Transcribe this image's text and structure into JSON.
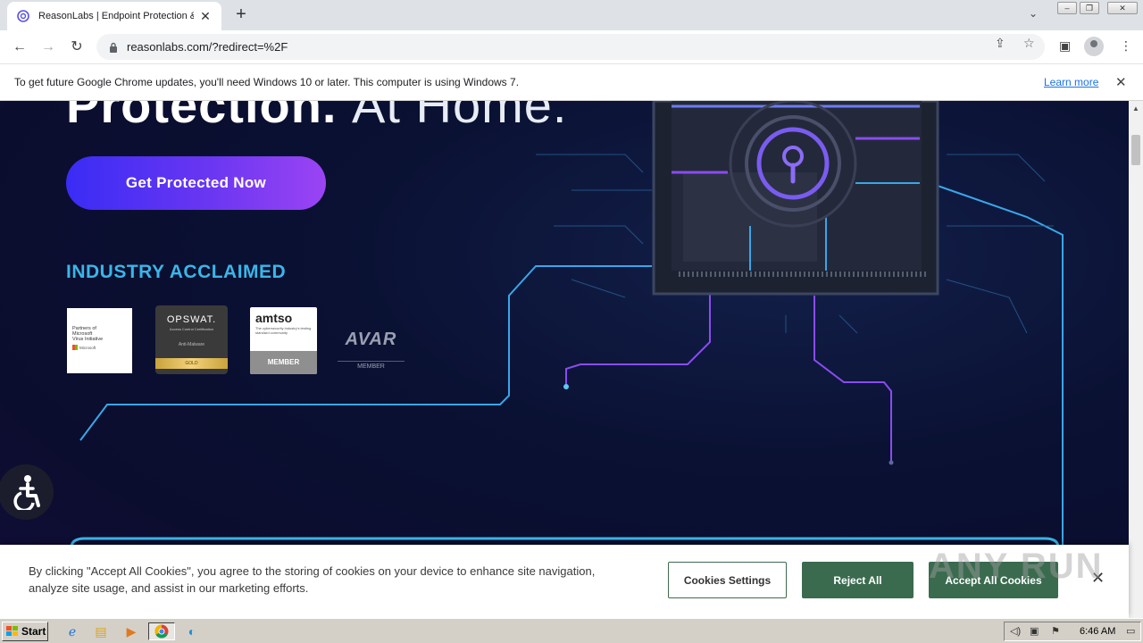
{
  "browser": {
    "tab": {
      "title": "ReasonLabs | Endpoint Protection &"
    },
    "address": {
      "url": "reasonlabs.com/?redirect=%2F"
    },
    "window_controls": {
      "minimize": "–",
      "restore": "❐",
      "close": "✕"
    }
  },
  "infobar": {
    "message": "To get future Google Chrome updates, you'll need Windows 10 or later. This computer is using Windows 7.",
    "link": "Learn more"
  },
  "hero": {
    "title_bold": "Protection.",
    "title_light": "At Home.",
    "cta_label": "Get Protected Now",
    "acclaim_heading": "INDUSTRY ACCLAIMED"
  },
  "badges": {
    "microsoft": {
      "line1": "Partners of",
      "line2": "Microsoft",
      "line3": "Virus Initiative",
      "logo_text": "Microsoft"
    },
    "opswat": {
      "name": "OPSWAT.",
      "sub": "Access Control Certification",
      "category": "Anti-Malware",
      "level": "GOLD"
    },
    "amtso": {
      "name": "amtso",
      "sub": "The cybersecurity industry's testing standard community",
      "member": "MEMBER"
    },
    "avar": {
      "name": "AVAR",
      "member": "MEMBER"
    }
  },
  "cookie_banner": {
    "text": "By clicking \"Accept All Cookies\", you agree to the storing of cookies on your device to enhance site navigation, analyze site usage, and assist in our marketing efforts.",
    "settings_label": "Cookies Settings",
    "reject_label": "Reject All",
    "accept_label": "Accept All Cookies",
    "close": "✕"
  },
  "watermark": "ANY RUN",
  "taskbar": {
    "start_label": "Start",
    "clock": "6:46 AM"
  },
  "colors": {
    "accent_blue": "#3ab6e8",
    "cta_gradient_start": "#3a2cf5",
    "cta_gradient_end": "#9b44f3",
    "cookie_green": "#3b6b4f",
    "page_bg": "#0a1133"
  },
  "icons": [
    "favicon-icon",
    "close-icon",
    "plus-icon",
    "chevron-down-icon",
    "back-icon",
    "forward-icon",
    "reload-icon",
    "lock-icon",
    "share-icon",
    "star-icon",
    "sidepanel-icon",
    "profile-icon",
    "menu-icon",
    "accessibility-icon",
    "ie-icon",
    "explorer-icon",
    "media-icon",
    "chrome-icon",
    "edge-icon",
    "volume-icon",
    "network-icon",
    "flag-icon",
    "monitor-icon"
  ]
}
